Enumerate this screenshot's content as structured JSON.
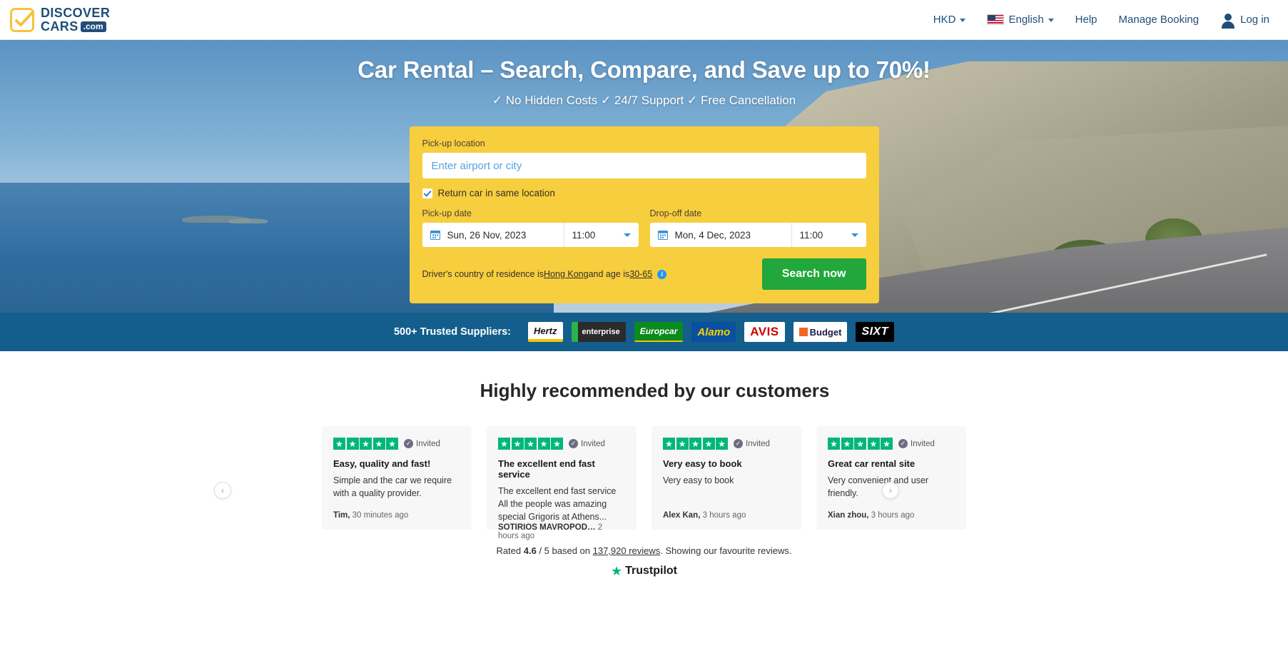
{
  "header": {
    "logo": {
      "line1": "DISCOVER",
      "line2": "CARS",
      "badge": ".com"
    },
    "nav": [
      {
        "label": "HKD",
        "icon": "chevron-down-icon"
      },
      {
        "label": "English",
        "icon": "us-flag-icon"
      },
      {
        "label": "Help"
      },
      {
        "label": "Manage Booking"
      },
      {
        "label": "Log in",
        "icon": "user-icon"
      }
    ]
  },
  "hero": {
    "title": "Car Rental – Search, Compare, and Save up to 70%!",
    "subtitle": "✓ No Hidden Costs ✓ 24/7 Support ✓ Free Cancellation"
  },
  "search_form": {
    "pickup_location_label": "Pick-up location",
    "pickup_location_value": "",
    "pickup_location_placeholder": "Enter airport or city",
    "same_location_label": "Return car in same location",
    "same_location_checked": true,
    "pickup_date_label": "Pick-up date",
    "pickup_date_value": "Sun, 26 Nov, 2023",
    "pickup_time_value": "11:00",
    "dropoff_date_label": "Drop-off date",
    "dropoff_date_value": "Mon, 4 Dec, 2023",
    "dropoff_time_value": "11:00",
    "driver_prefix": "Driver's country of residence is ",
    "driver_country": "Hong Kong",
    "driver_middle": " and age is ",
    "driver_age": "30-65",
    "info_icon": "info-icon",
    "search_button": "Search now"
  },
  "suppliers": {
    "label": "500+ Trusted Suppliers:",
    "items": [
      {
        "name": "Hertz"
      },
      {
        "name": "enterprise"
      },
      {
        "name": "Europcar"
      },
      {
        "name": "Alamo"
      },
      {
        "name": "AVIS"
      },
      {
        "name": "Budget"
      },
      {
        "name": "SIXT"
      }
    ]
  },
  "reviews": {
    "heading": "Highly recommended by our customers",
    "invited_label": "Invited",
    "prev_arrow": "‹",
    "next_arrow": "›",
    "cards": [
      {
        "stars": 5,
        "title": "Easy, quality and fast!",
        "body": "Simple and the car we require with a quality provider.",
        "author": "Tim,",
        "time": " 30 minutes ago"
      },
      {
        "stars": 5,
        "title": "The excellent end fast service",
        "body": "The excellent end fast service All the people was amazing special Grigoris at Athens...",
        "author": "SOTIRIOS MAVROPOD…",
        "time": " 2 hours ago"
      },
      {
        "stars": 5,
        "title": "Very easy to book",
        "body": "Very easy to book",
        "author": "Alex Kan,",
        "time": " 3 hours ago"
      },
      {
        "stars": 5,
        "title": "Great car rental site",
        "body": "Very convenient and user friendly.",
        "author": "Xian zhou,",
        "time": " 3 hours ago"
      }
    ],
    "rated_prefix": "Rated ",
    "rated_score": "4.6",
    "rated_middle": " / 5 based on ",
    "rated_count": "137,920 reviews",
    "rated_suffix": ". Showing our favourite reviews.",
    "trustpilot_name": "Trustpilot"
  },
  "colors": {
    "brand_navy": "#1F4E79",
    "brand_yellow": "#F7CE3E",
    "search_green": "#21A73C",
    "suppliers_blue": "#135E8C",
    "trustpilot_green": "#00B67A"
  }
}
